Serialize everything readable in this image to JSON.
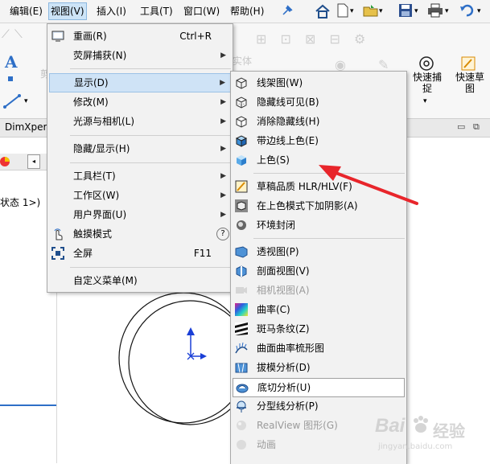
{
  "menubar": {
    "items": [
      "编辑(E)",
      "视图(V)",
      "插入(I)",
      "工具(T)",
      "窗口(W)",
      "帮助(H)"
    ]
  },
  "ribbon": {
    "solid_label": "实体",
    "quick_snap": "快速捕捉",
    "quick_sketch": "快速草图"
  },
  "feature_tabs": {
    "dimxpert": "DimXpert"
  },
  "tree": {
    "state_text": "状态 1>)"
  },
  "view_menu": {
    "items": [
      {
        "label": "重画(R)",
        "shortcut": "Ctrl+R"
      },
      {
        "label": "荧屏捕获(N)"
      },
      {
        "label": "显示(D)"
      },
      {
        "label": "修改(M)"
      },
      {
        "label": "光源与相机(L)"
      },
      {
        "label": "隐藏/显示(H)"
      },
      {
        "label": "工具栏(T)"
      },
      {
        "label": "工作区(W)"
      },
      {
        "label": "用户界面(U)"
      },
      {
        "label": "触摸模式"
      },
      {
        "label": "全屏",
        "shortcut": "F11"
      },
      {
        "label": "自定义菜单(M)"
      }
    ]
  },
  "display_menu": {
    "items": [
      {
        "label": "线架图(W)"
      },
      {
        "label": "隐藏线可见(B)"
      },
      {
        "label": "消除隐藏线(H)"
      },
      {
        "label": "带边线上色(E)"
      },
      {
        "label": "上色(S)"
      },
      {
        "label": "草稿品质 HLR/HLV(F)"
      },
      {
        "label": "在上色模式下加阴影(A)"
      },
      {
        "label": "环境封闭"
      },
      {
        "label": "透视图(P)"
      },
      {
        "label": "剖面视图(V)"
      },
      {
        "label": "相机视图(A)"
      },
      {
        "label": "曲率(C)"
      },
      {
        "label": "斑马条纹(Z)"
      },
      {
        "label": "曲面曲率梳形图"
      },
      {
        "label": "拔模分析(D)"
      },
      {
        "label": "底切分析(U)"
      },
      {
        "label": "分型线分析(P)"
      },
      {
        "label": "RealView 图形(G)"
      },
      {
        "label": "动画"
      }
    ]
  },
  "watermark": {
    "brand": "Bai",
    "brand2": "经验",
    "url": "jingyan.baidu.com"
  },
  "colors": {
    "accent": "#2e6fc7",
    "arrow": "#e8252b"
  }
}
